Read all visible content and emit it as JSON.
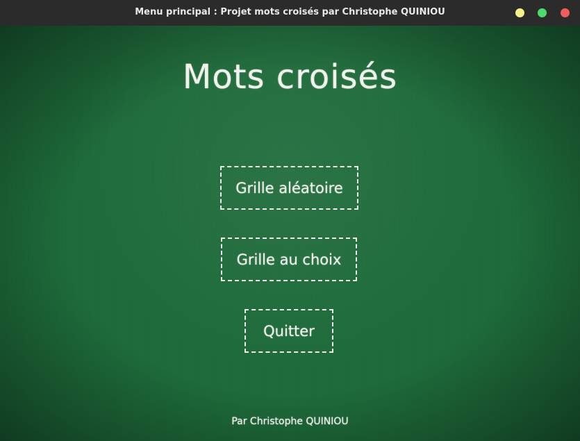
{
  "window": {
    "title": "Menu principal : Projet mots croisés par Christophe QUINIOU",
    "controls": {
      "minimize_color": "#f4f08a",
      "maximize_color": "#4cdb6e",
      "close_color": "#f25c5c"
    }
  },
  "board": {
    "title": "Mots croisés",
    "background_color": "#1d6a3a",
    "chalk_color": "#f2f2ec"
  },
  "menu": {
    "random_grid_label": "Grille aléatoire",
    "chosen_grid_label": "Grille au choix",
    "quit_label": "Quitter"
  },
  "footer": {
    "credit": "Par Christophe QUINIOU"
  }
}
